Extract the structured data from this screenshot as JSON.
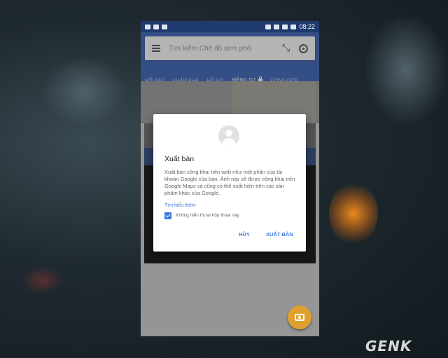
{
  "status_bar": {
    "time": "08:22"
  },
  "search": {
    "placeholder": "Tìm kiếm Chế độ xem phố"
  },
  "tabs": [
    {
      "label": "NỔI BẬT"
    },
    {
      "label": "KHÁM PHÁ"
    },
    {
      "label": "HỒ SƠ"
    },
    {
      "label": "RIÊNG TƯ"
    },
    {
      "label": "ĐÓNG GÓP"
    }
  ],
  "dialog": {
    "title": "Xuất bản",
    "body": "Xuất bản công khai trên web như một phần của tài khoản Google của bạn. Ảnh này sẽ được công khai trên Google Maps và cũng có thể xuất hiện trên các sản phẩm khác của Google.",
    "link": "Tìm hiểu thêm",
    "checkbox_label": "Không hiển thị lại hộp thoại này",
    "checkbox_checked": true,
    "cancel_label": "HỦY",
    "publish_label": "XUẤT BẢN"
  },
  "watermark": "GENK",
  "colors": {
    "accent": "#3b7be0",
    "app_bar": "#3b63b8",
    "fab": "#e0a030"
  }
}
